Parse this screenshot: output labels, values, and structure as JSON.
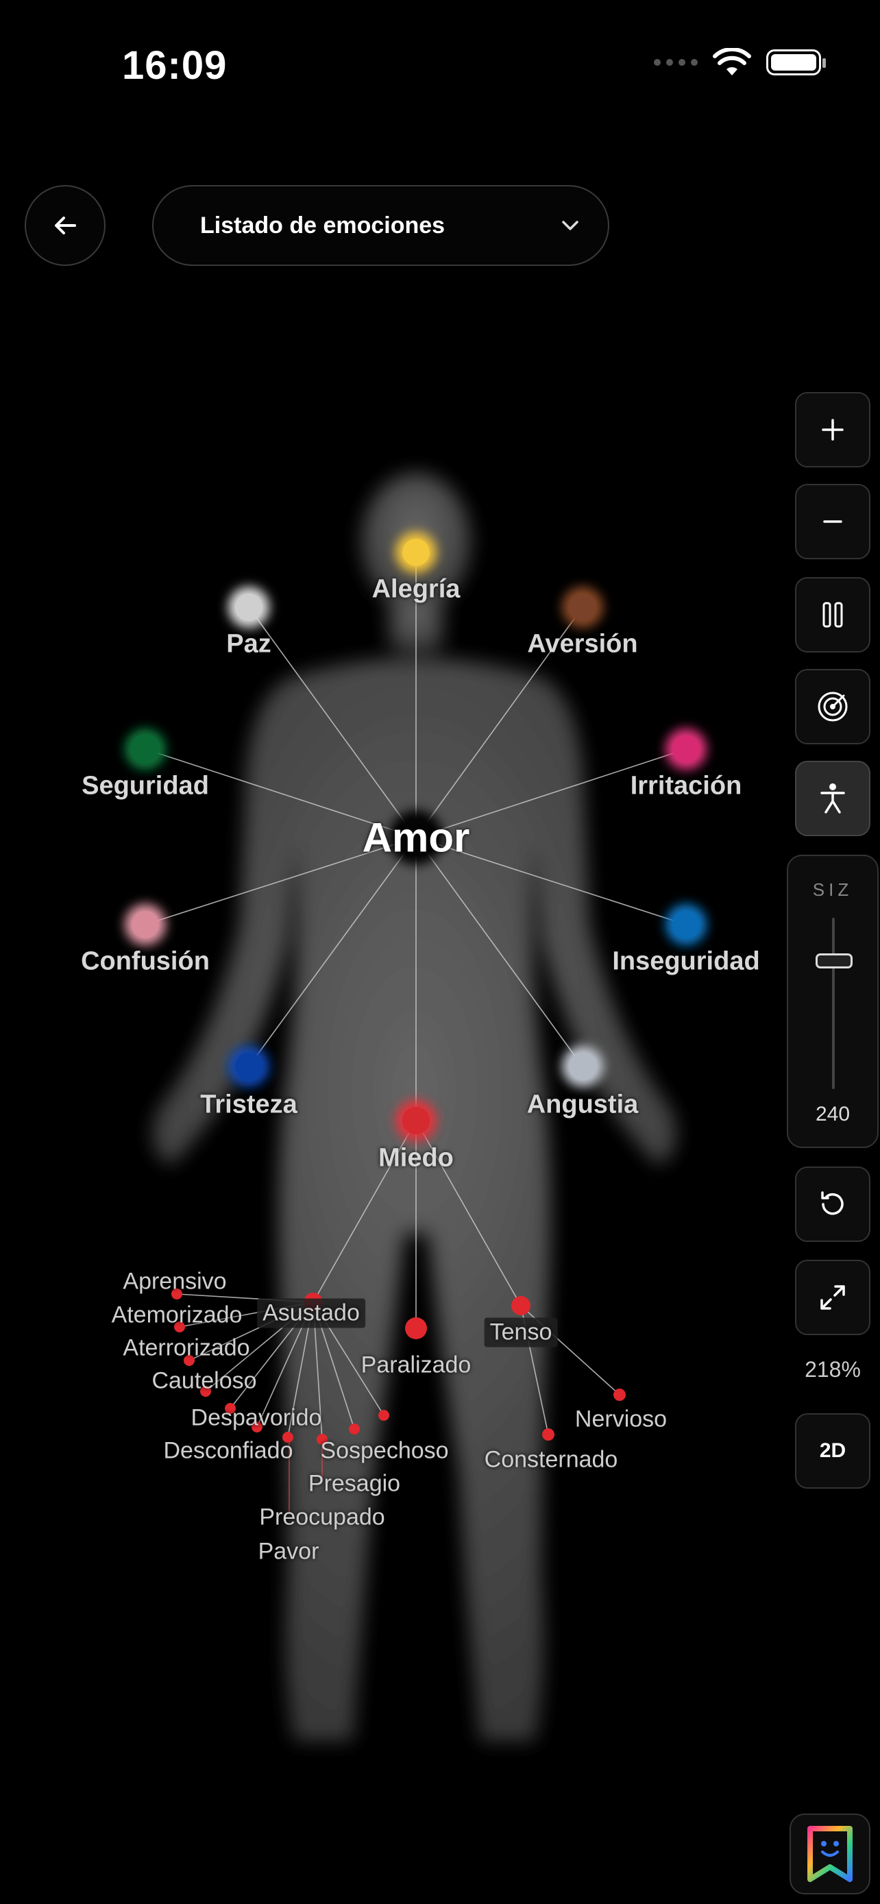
{
  "status_bar": {
    "time": "16:09"
  },
  "header": {
    "dropdown_label": "Listado de emociones"
  },
  "toolbar": {
    "size_label": "SIZ",
    "size_value": "240",
    "zoom": "218%",
    "view_mode": "2D",
    "icons": [
      "plus-icon",
      "minus-icon",
      "pause-icon",
      "radar-icon",
      "person-icon",
      "reset-icon",
      "expand-icon"
    ]
  },
  "graph": {
    "center": "Amor",
    "emotions": [
      {
        "label": "Alegría",
        "color": "#f2c33a"
      },
      {
        "label": "Paz",
        "color": "#d9d9d9"
      },
      {
        "label": "Aversión",
        "color": "#8a4a28"
      },
      {
        "label": "Seguridad",
        "color": "#0e7a3c"
      },
      {
        "label": "Irritación",
        "color": "#e6357f"
      },
      {
        "label": "Confusión",
        "color": "#e39aa8"
      },
      {
        "label": "Inseguridad",
        "color": "#0a78c8"
      },
      {
        "label": "Tristeza",
        "color": "#0a48b8"
      },
      {
        "label": "Angustia",
        "color": "#c7cdd6"
      },
      {
        "label": "Miedo",
        "color": "#e8333a"
      }
    ],
    "miedo_children": [
      "Asustado",
      "Paralizado",
      "Tenso"
    ],
    "asustado_children": [
      "Aprensivo",
      "Atemorizado",
      "Aterrorizado",
      "Cauteloso",
      "Despavorido",
      "Desconfiado",
      "Sospechoso",
      "Presagio",
      "Preocupado",
      "Pavor"
    ],
    "tenso_children": [
      "Nervioso",
      "Consternado"
    ]
  }
}
